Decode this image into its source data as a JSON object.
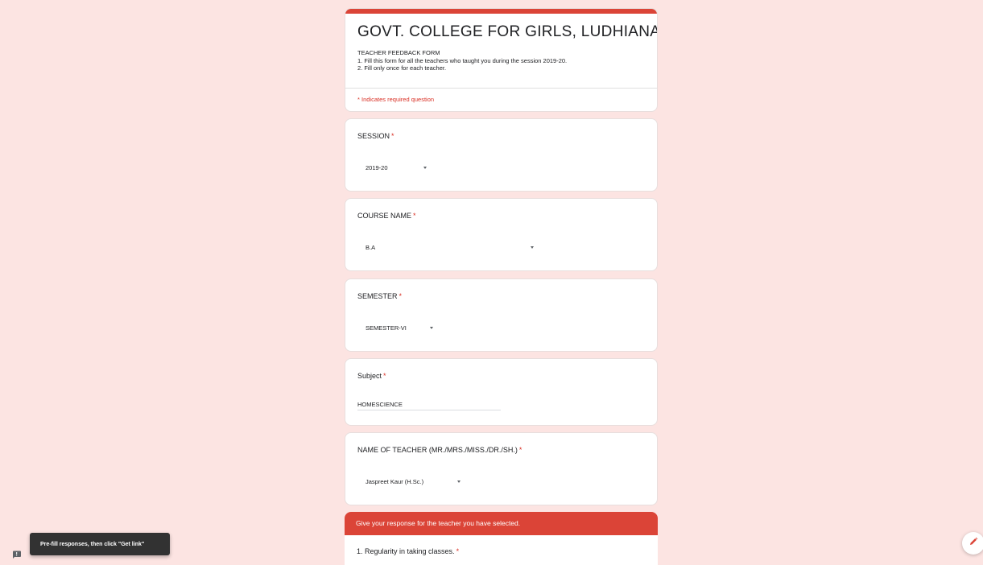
{
  "form": {
    "title": "GOVT. COLLEGE FOR GIRLS, LUDHIANA",
    "description_lines": [
      "TEACHER FEEDBACK FORM",
      "1. Fill this form for all the teachers who taught you during the session 2019-20.",
      "2. Fill only once for each teacher."
    ],
    "required_note": "* Indicates required question",
    "accent_color": "#db4437",
    "background_color": "#fce4e2"
  },
  "questions": {
    "session": {
      "label": "SESSION",
      "required_mark": "*",
      "value": "2019-20"
    },
    "course": {
      "label": "COURSE NAME",
      "required_mark": "*",
      "value": "B.A"
    },
    "semester": {
      "label": "SEMESTER",
      "required_mark": "*",
      "value": "SEMESTER-VI"
    },
    "subject": {
      "label": "Subject",
      "required_mark": "*",
      "value": "HOMESCIENCE"
    },
    "teacher": {
      "label": "NAME OF TEACHER (MR./MRS./MISS./DR./SH.)",
      "required_mark": "*",
      "value": "Jaspreet Kaur (H.Sc.)"
    }
  },
  "section": {
    "title": "Give your response for the teacher you have selected.",
    "first_question": "1. Regularity in taking classes.",
    "required_mark": "*"
  },
  "toast": {
    "message": "Pre-fill responses, then click \"Get link\""
  },
  "icons": {
    "feedback": "feedback-icon",
    "edit": "pencil-icon"
  }
}
